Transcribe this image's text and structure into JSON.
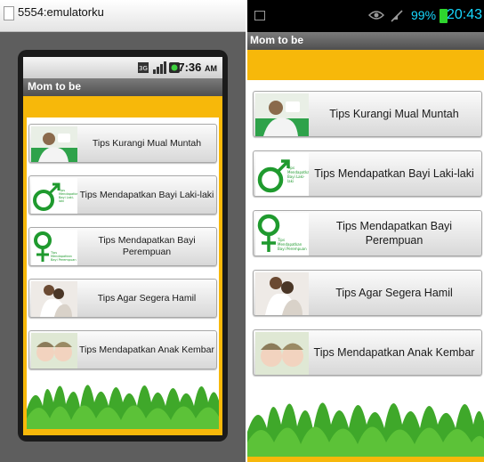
{
  "emulator": {
    "title": "5554:emulatorku"
  },
  "left_screen": {
    "status": {
      "time": "7:36",
      "ampm": "AM"
    },
    "app_title": "Mom to be",
    "buttons": [
      {
        "label": "Tips Kurangi Mual Muntah"
      },
      {
        "label": "Tips Mendapatkan Bayi Laki-laki",
        "logo_text": "Tips Mendapatkan Bayi Laki-laki"
      },
      {
        "label": "Tips Mendapatkan Bayi Perempuan",
        "logo_text": "Tips Mendapatkan Bayi Perempuan"
      },
      {
        "label": "Tips Agar Segera Hamil"
      },
      {
        "label": "Tips Mendapatkan Anak Kembar"
      }
    ]
  },
  "right_screen": {
    "status": {
      "battery": "99%",
      "time": "20:43"
    },
    "app_title": "Mom to be",
    "buttons": [
      {
        "label": "Tips Kurangi Mual Muntah"
      },
      {
        "label": "Tips Mendapatkan Bayi Laki-laki",
        "logo_text": "Tips Mendapatkan Bayi Laki-laki"
      },
      {
        "label": "Tips Mendapatkan Bayi Perempuan",
        "logo_text": "Tips Mendapatkan Bayi Perempuan"
      },
      {
        "label": "Tips Agar Segera Hamil"
      },
      {
        "label": "Tips Mendapatkan Anak Kembar"
      }
    ]
  },
  "colors": {
    "accent": "#f7b80a",
    "status_text": "#17d9ff",
    "battery": "#2ed52e",
    "symbol_green": "#1f9a2e",
    "grass": "#3fa82a"
  },
  "icons": [
    "window-icon",
    "sd-card-icon",
    "signal-icon",
    "battery-icon",
    "picture-icon",
    "eye-icon",
    "mute-icon"
  ]
}
